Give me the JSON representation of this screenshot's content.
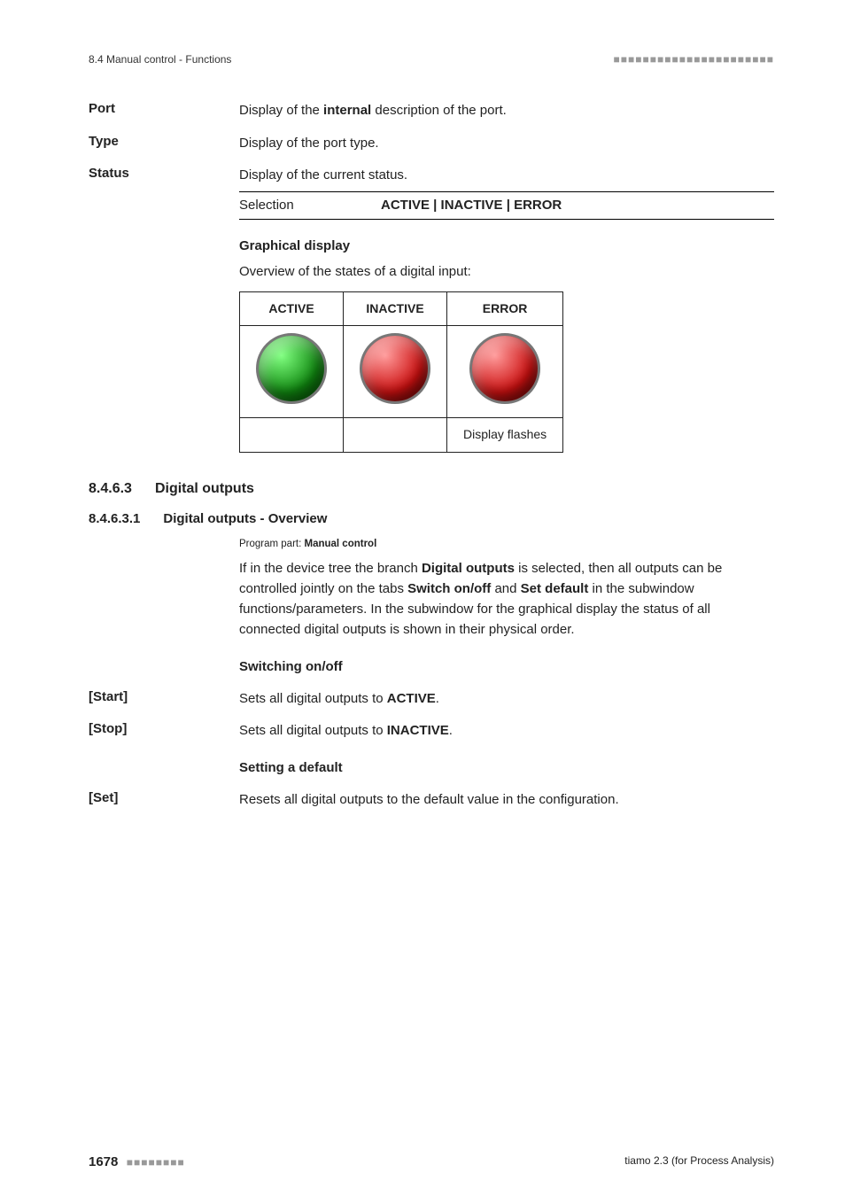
{
  "running_head": {
    "left": "8.4 Manual control - Functions",
    "right_decor": "■■■■■■■■■■■■■■■■■■■■■■"
  },
  "defs": {
    "port": {
      "term": "Port",
      "desc_prefix": "Display of the ",
      "desc_bold": "internal",
      "desc_suffix": " description of the port."
    },
    "type": {
      "term": "Type",
      "desc": "Display of the port type."
    },
    "status": {
      "term": "Status",
      "desc": "Display of the current status.",
      "selection_label": "Selection",
      "selection_values": "ACTIVE | INACTIVE | ERROR"
    }
  },
  "graphical": {
    "heading": "Graphical display",
    "lead": "Overview of the states of a digital input:",
    "headers": {
      "active": "ACTIVE",
      "inactive": "INACTIVE",
      "error": "ERROR"
    },
    "error_note": "Display flashes"
  },
  "sec1": {
    "num": "8.4.6.3",
    "title": "Digital outputs"
  },
  "sec2": {
    "num": "8.4.6.3.1",
    "title": "Digital outputs - Overview"
  },
  "program_part_label": "Program part: ",
  "program_part_value": "Manual control",
  "intro": {
    "p1a": "If in the device tree the branch ",
    "b1": "Digital outputs",
    "p1b": " is selected, then all outputs can be controlled jointly on the tabs ",
    "b2": "Switch on/off",
    "p1c": " and ",
    "b3": "Set default",
    "p1d": " in the subwindow functions/parameters. In the subwindow for the graphical display the status of all connected digital outputs is shown in their physical order."
  },
  "switching": {
    "heading": "Switching on/off",
    "start": {
      "term": "[Start]",
      "pre": "Sets all digital outputs to ",
      "val": "ACTIVE",
      "post": "."
    },
    "stop": {
      "term": "[Stop]",
      "pre": "Sets all digital outputs to ",
      "val": "INACTIVE",
      "post": "."
    }
  },
  "setting": {
    "heading": "Setting a default",
    "set": {
      "term": "[Set]",
      "desc": "Resets all digital outputs to the default value in the configuration."
    }
  },
  "footer": {
    "page": "1678",
    "decor": "■■■■■■■■",
    "right": "tiamo 2.3 (for Process Analysis)"
  }
}
